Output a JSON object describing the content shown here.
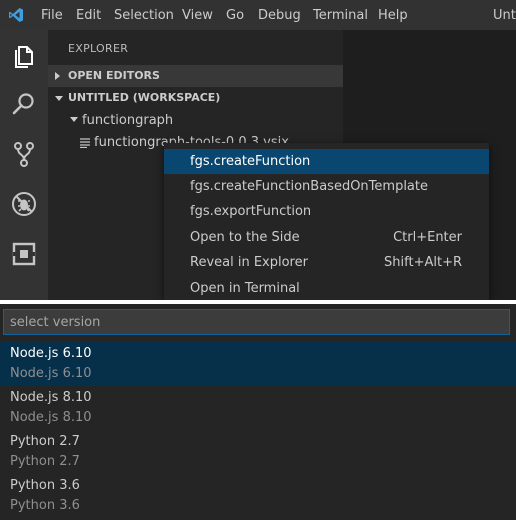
{
  "titlebar": {
    "app_icon": "vscode-logo-icon",
    "menu": [
      "File",
      "Edit",
      "Selection",
      "View",
      "Go",
      "Debug",
      "Terminal",
      "Help"
    ],
    "window_title": "Unti"
  },
  "activity_bar": {
    "icons": [
      "explorer-icon",
      "search-icon",
      "source-control-icon",
      "debug-icon",
      "extensions-icon"
    ]
  },
  "explorer": {
    "title": "EXPLORER",
    "sections": [
      {
        "label": "OPEN EDITORS",
        "expanded": false
      },
      {
        "label": "UNTITLED (WORKSPACE)",
        "expanded": true
      }
    ],
    "folder": "functiongraph",
    "file": "functiongraph-tools-0.0.3.vsix"
  },
  "context_menu": {
    "items": [
      {
        "label": "fgs.createFunction",
        "shortcut": "",
        "selected": true
      },
      {
        "label": "fgs.createFunctionBasedOnTemplate",
        "shortcut": ""
      },
      {
        "label": "fgs.exportFunction",
        "shortcut": ""
      },
      {
        "label": "Open to the Side",
        "shortcut": "Ctrl+Enter"
      },
      {
        "label": "Reveal in Explorer",
        "shortcut": "Shift+Alt+R"
      },
      {
        "label": "Open in Terminal",
        "shortcut": ""
      }
    ]
  },
  "quick_pick": {
    "placeholder": "select version",
    "value": "",
    "items": [
      {
        "label": "Node.js 6.10",
        "description": "Node.js 6.10",
        "selected": true
      },
      {
        "label": "Node.js 8.10",
        "description": "Node.js 8.10"
      },
      {
        "label": "Python 2.7",
        "description": "Python 2.7"
      },
      {
        "label": "Python 3.6",
        "description": "Python 3.6"
      }
    ]
  },
  "colors": {
    "accent": "#0e639c",
    "selection": "#094771",
    "quickpick_selection": "#062f4a"
  }
}
